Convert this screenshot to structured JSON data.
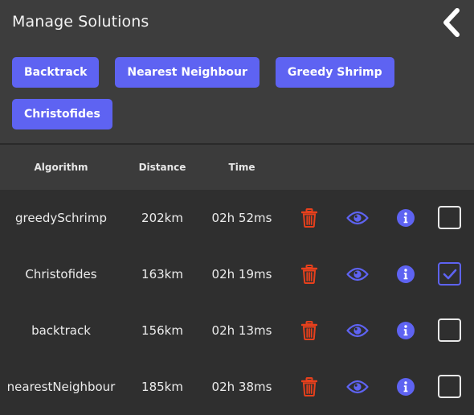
{
  "page": {
    "title": "Manage Solutions"
  },
  "algorithms": [
    {
      "label": "Backtrack"
    },
    {
      "label": "Nearest Neighbour"
    },
    {
      "label": "Greedy Shrimp"
    },
    {
      "label": "Christofides"
    }
  ],
  "table": {
    "headers": {
      "algorithm": "Algorithm",
      "distance": "Distance",
      "time": "Time"
    },
    "rows": [
      {
        "algorithm": "greedySchrimp",
        "distance": "202km",
        "time": "02h 52ms",
        "selected": false
      },
      {
        "algorithm": "Christofides",
        "distance": "163km",
        "time": "02h 19ms",
        "selected": true
      },
      {
        "algorithm": "backtrack",
        "distance": "156km",
        "time": "02h 13ms",
        "selected": false
      },
      {
        "algorithm": "nearestNeighbour",
        "distance": "185km",
        "time": "02h 38ms",
        "selected": false
      }
    ]
  },
  "icons": {
    "back": "chevron-left-icon",
    "delete": "trash-icon",
    "view": "eye-icon",
    "info": "info-icon",
    "check": "check-icon"
  },
  "colors": {
    "accent": "#5e63f2",
    "delete": "#e8401c",
    "background": "#2f2f2f",
    "header_background": "#3d3d3d"
  }
}
